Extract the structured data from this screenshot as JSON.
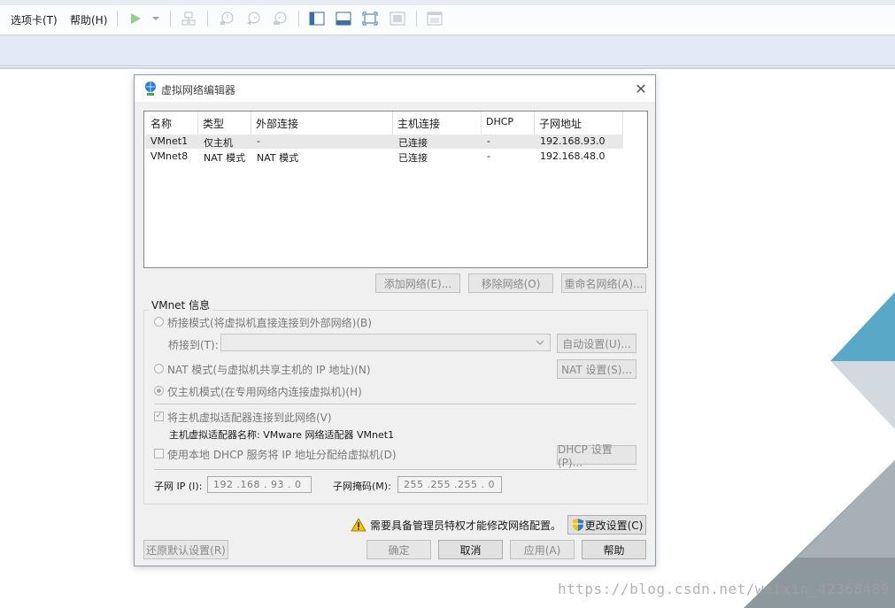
{
  "menu": {
    "options": "选项卡(T)",
    "help": "帮助(H)"
  },
  "icons": [
    "play-icon",
    "dropdown-arrow-icon",
    "network-icon",
    "snapshot-icon",
    "snapshot-revert-icon",
    "snapshot-manager-icon",
    "view-sidebar-icon",
    "view-console-icon",
    "fullscreen-icon",
    "unity-icon",
    "thumbnail-icon"
  ],
  "dialog": {
    "title": "虚拟网络编辑器",
    "list": {
      "headers": [
        "名称",
        "类型",
        "外部连接",
        "主机连接",
        "DHCP",
        "子网地址"
      ],
      "rows": [
        [
          "VMnet1",
          "仅主机",
          "-",
          "已连接",
          "-",
          "192.168.93.0"
        ],
        [
          "VMnet8",
          "NAT 模式",
          "NAT 模式",
          "已连接",
          "-",
          "192.168.48.0"
        ]
      ]
    },
    "buttons": {
      "add": "添加网络(E)...",
      "remove": "移除网络(O)",
      "rename": "重命名网络(A)..."
    },
    "vmnet": {
      "title": "VMnet 信息",
      "bridged": "桥接模式(将虚拟机直接连接到外部网络)(B)",
      "bridge_to": "桥接到(T):",
      "auto_settings": "自动设置(U)...",
      "nat": "NAT 模式(与虚拟机共享主机的 IP 地址)(N)",
      "nat_settings": "NAT 设置(S)...",
      "host_only": "仅主机模式(在专用网络内连接虚拟机)(H)",
      "connect_adapter": "将主机虚拟适配器连接到此网络(V)",
      "adapter_name": "主机虚拟适配器名称: VMware 网络适配器 VMnet1",
      "dhcp": "使用本地 DHCP 服务将 IP 地址分配给虚拟机(D)",
      "dhcp_settings": "DHCP 设置(P)...",
      "subnet_ip_label": "子网 IP (I):",
      "subnet_ip": "192 .168 . 93 . 0",
      "mask_label": "子网掩码(M):",
      "mask": "255 .255 .255 . 0"
    },
    "admin_notice": "需要具备管理员特权才能修改网络配置。",
    "change_settings": "更改设置(C)",
    "restore_defaults": "还原默认设置(R)",
    "ok": "确定",
    "cancel": "取消",
    "apply": "应用(A)",
    "help": "帮助"
  },
  "watermark": "https://blog.csdn.net/weixin_42368489",
  "colors": {
    "accent_blue": "#2b7bd6",
    "play_green": "#3cb043",
    "warning_yellow": "#f5c400",
    "band": "#e3eaf6"
  }
}
